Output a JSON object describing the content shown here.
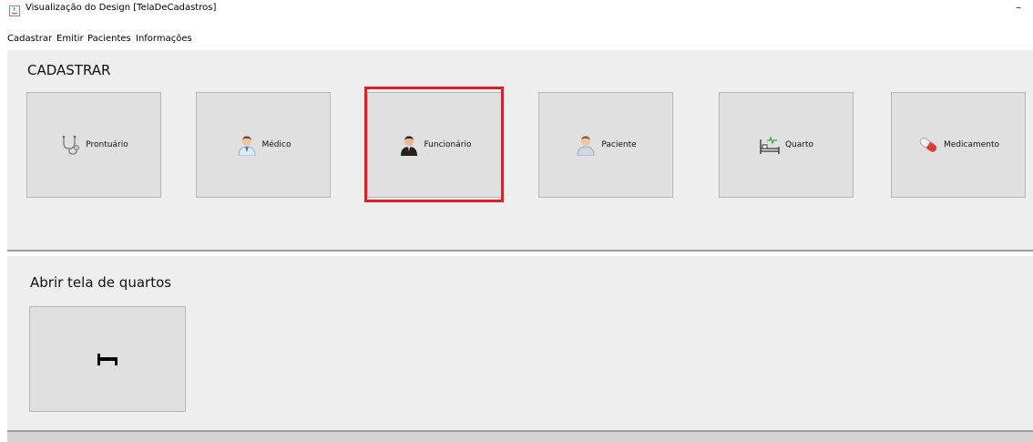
{
  "window": {
    "title": "Visualização do Design [TelaDeCadastros]",
    "minimize_symbol": "–"
  },
  "menu": [
    "Cadastrar",
    "Emitir",
    "Pacientes",
    "Informações"
  ],
  "cadastrar": {
    "heading": "CADASTRAR",
    "buttons": [
      {
        "label": "Prontuário",
        "icon": "stethoscope-icon"
      },
      {
        "label": "Médico",
        "icon": "doctor-icon"
      },
      {
        "label": "Funcionário",
        "icon": "employee-icon",
        "highlighted": true,
        "highlight_color": "#e01e26"
      },
      {
        "label": "Paciente",
        "icon": "patient-icon"
      },
      {
        "label": "Quarto",
        "icon": "hospital-bed-icon"
      },
      {
        "label": "Medicamento",
        "icon": "pill-icon"
      }
    ]
  },
  "quartos": {
    "heading": "Abrir tela de quartos",
    "button_icon": "bed-icon"
  }
}
